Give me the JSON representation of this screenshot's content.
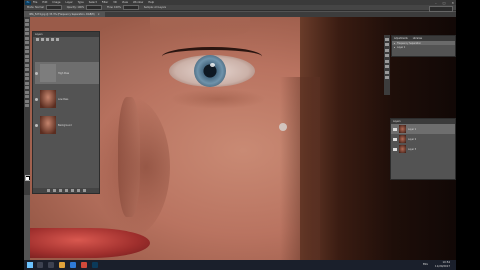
{
  "menubar": {
    "logo": "Ps",
    "items": [
      "File",
      "Edit",
      "Image",
      "Layer",
      "Type",
      "Select",
      "Filter",
      "3D",
      "View",
      "Window",
      "Help"
    ]
  },
  "options": {
    "items": [
      "Mode: Normal",
      "Opacity: 100%",
      "Flow: 100%",
      "Sample: All Layers"
    ]
  },
  "document": {
    "tab": "IMG_5274.jpg @ 33.3% (Frequency Separation, RGB/8)"
  },
  "left_panel": {
    "title": "Layers",
    "layers": [
      {
        "name": "High Pass"
      },
      {
        "name": "Low Pass"
      },
      {
        "name": "Background"
      }
    ]
  },
  "right_top_panel": {
    "tabs": [
      "Adjustments",
      "Libraries"
    ],
    "lines": [
      "Frequency Separation",
      "Layer 1"
    ]
  },
  "right_layers_panel": {
    "title": "Layers",
    "rows": [
      "Layer 1",
      "Layer 2",
      "Layer 3"
    ]
  },
  "taskbar": {
    "time": "10:54",
    "date": "11/20/2017",
    "lang": "ENG"
  },
  "colors": {
    "windows_blue": "#6cc3ff",
    "ps_dark": "#3a3a3a"
  }
}
